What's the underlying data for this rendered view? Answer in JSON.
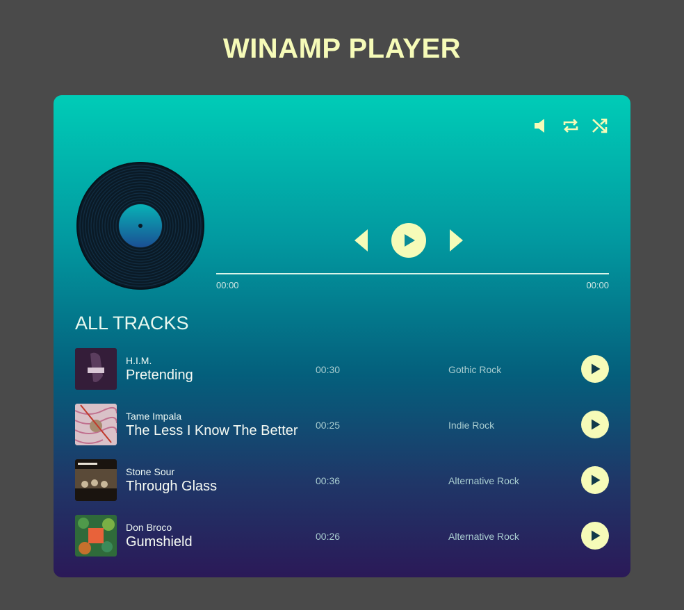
{
  "app": {
    "title": "WINAMP PLAYER"
  },
  "colors": {
    "accent": "#f6fbb8",
    "background": "#4a4a4a",
    "panel_top": "#00ccb7",
    "panel_bottom": "#2b1958"
  },
  "controls": {
    "icons": [
      "volume-icon",
      "repeat-icon",
      "shuffle-icon"
    ]
  },
  "player": {
    "current_time": "00:00",
    "total_time": "00:00",
    "progress": 0
  },
  "tracks_section": {
    "title": "ALL TRACKS"
  },
  "tracks": [
    {
      "artist": "H.I.M.",
      "title": "Pretending",
      "duration": "00:30",
      "genre": "Gothic Rock"
    },
    {
      "artist": "Tame Impala",
      "title": "The Less I Know The Better",
      "duration": "00:25",
      "genre": "Indie Rock"
    },
    {
      "artist": "Stone Sour",
      "title": "Through Glass",
      "duration": "00:36",
      "genre": "Alternative Rock"
    },
    {
      "artist": "Don Broco",
      "title": "Gumshield",
      "duration": "00:26",
      "genre": "Alternative Rock"
    }
  ]
}
